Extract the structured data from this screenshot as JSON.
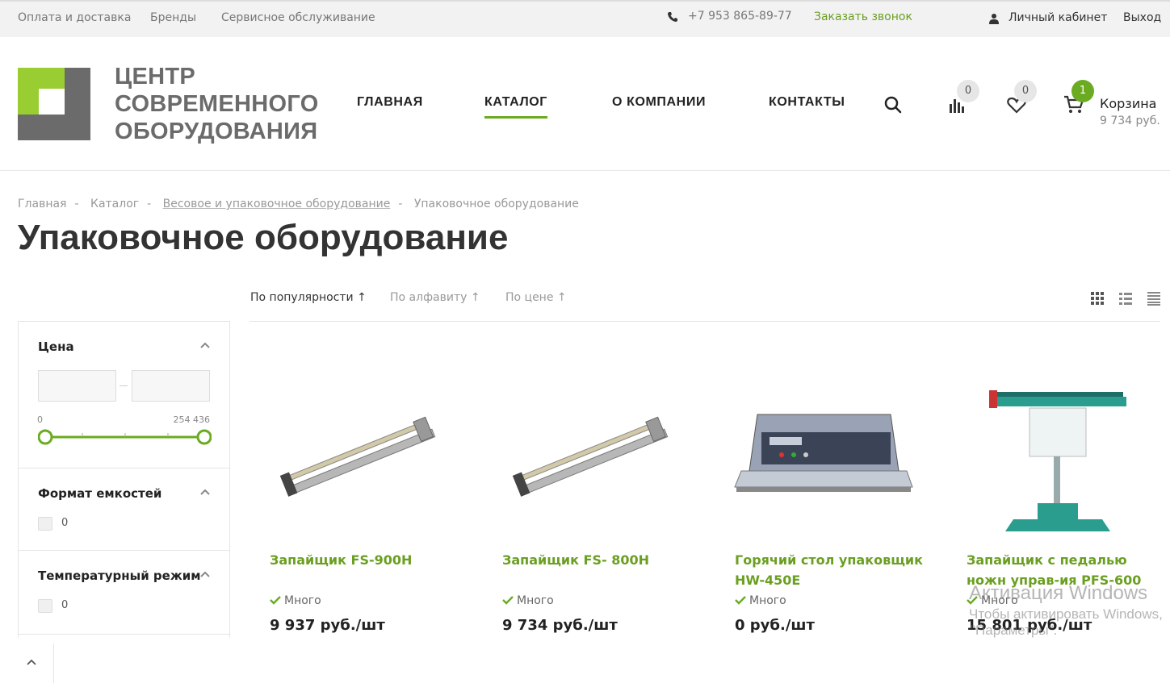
{
  "topbar": {
    "pay_delivery": "Оплата и доставка",
    "brands": "Бренды",
    "service": "Сервисное обслуживание",
    "phone": "+7 953 865-89-77",
    "callback": "Заказать звонок",
    "cabinet": "Личный кабинет",
    "exit": "Выход"
  },
  "logo": {
    "line1": "ЦЕНТР",
    "line2": "СОВРЕМЕННОГО",
    "line3": "ОБОРУДОВАНИЯ",
    "colors": {
      "green": "#9acd32",
      "gray": "#6b6b6b"
    }
  },
  "nav": {
    "items": [
      "ГЛАВНАЯ",
      "КАТАЛОГ",
      "О КОМПАНИИ",
      "КОНТАКТЫ"
    ],
    "active": "КАТАЛОГ"
  },
  "header_icons": {
    "compare_count": "0",
    "favorites_count": "0",
    "cart_count": "1",
    "cart_label": "Корзина",
    "cart_total": "9 734 руб."
  },
  "breadcrumb": [
    "Главная",
    "Каталог",
    "Весовое и упаковочное оборудование",
    "Упаковочное оборудование"
  ],
  "page_title": "Упаковочное оборудование",
  "sort": {
    "popularity": "По популярности",
    "alphabet": "По алфавиту",
    "price": "По цене",
    "active": "По популярности"
  },
  "filters": {
    "price": {
      "title": "Цена",
      "min": "0",
      "max": "254 436",
      "range_fraction": [
        0,
        1
      ]
    },
    "container_format": {
      "title": "Формат емкостей",
      "option": "0"
    },
    "temperature": {
      "title": "Температурный режим",
      "option": "0"
    }
  },
  "products": [
    {
      "name": "Запайщик FS-900H",
      "stock": "Много",
      "price": "9 937 руб./шт"
    },
    {
      "name": "Запайщик FS- 800H",
      "stock": "Много",
      "price": "9 734 руб./шт"
    },
    {
      "name": "Горячий стол упаковщик HW-450E",
      "stock": "Много",
      "price": "0 руб./шт"
    },
    {
      "name": "Запайщик с педалью ножн управ-ия PFS-600",
      "stock": "Много",
      "price": "15 801 руб./шт"
    }
  ],
  "watermark": {
    "line1": "Активация Windows",
    "line2": "Чтобы активировать Windows,",
    "line3": "\"Параметры\"."
  },
  "accent_color": "#6aab21"
}
